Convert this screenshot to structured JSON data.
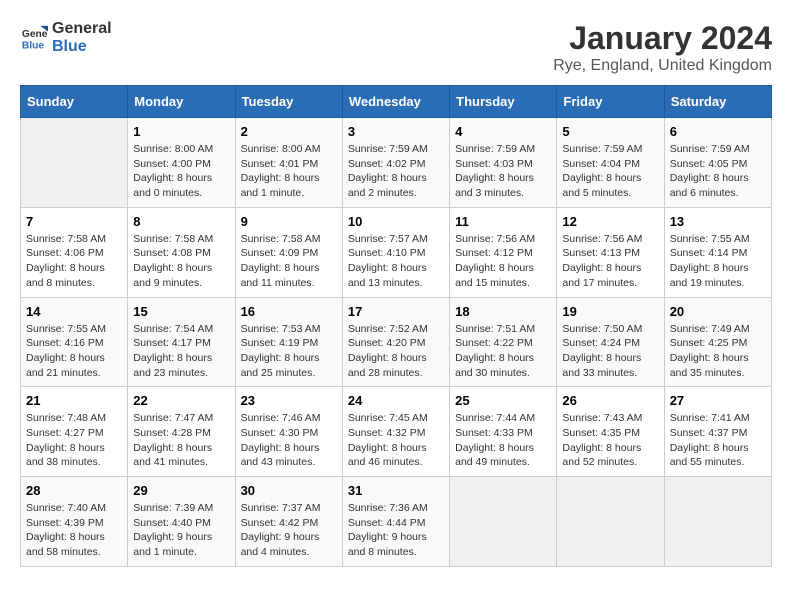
{
  "header": {
    "logo_general": "General",
    "logo_blue": "Blue",
    "title": "January 2024",
    "subtitle": "Rye, England, United Kingdom"
  },
  "calendar": {
    "days_of_week": [
      "Sunday",
      "Monday",
      "Tuesday",
      "Wednesday",
      "Thursday",
      "Friday",
      "Saturday"
    ],
    "weeks": [
      [
        {
          "day": "",
          "info": ""
        },
        {
          "day": "1",
          "info": "Sunrise: 8:00 AM\nSunset: 4:00 PM\nDaylight: 8 hours\nand 0 minutes."
        },
        {
          "day": "2",
          "info": "Sunrise: 8:00 AM\nSunset: 4:01 PM\nDaylight: 8 hours\nand 1 minute."
        },
        {
          "day": "3",
          "info": "Sunrise: 7:59 AM\nSunset: 4:02 PM\nDaylight: 8 hours\nand 2 minutes."
        },
        {
          "day": "4",
          "info": "Sunrise: 7:59 AM\nSunset: 4:03 PM\nDaylight: 8 hours\nand 3 minutes."
        },
        {
          "day": "5",
          "info": "Sunrise: 7:59 AM\nSunset: 4:04 PM\nDaylight: 8 hours\nand 5 minutes."
        },
        {
          "day": "6",
          "info": "Sunrise: 7:59 AM\nSunset: 4:05 PM\nDaylight: 8 hours\nand 6 minutes."
        }
      ],
      [
        {
          "day": "7",
          "info": "Sunrise: 7:58 AM\nSunset: 4:06 PM\nDaylight: 8 hours\nand 8 minutes."
        },
        {
          "day": "8",
          "info": "Sunrise: 7:58 AM\nSunset: 4:08 PM\nDaylight: 8 hours\nand 9 minutes."
        },
        {
          "day": "9",
          "info": "Sunrise: 7:58 AM\nSunset: 4:09 PM\nDaylight: 8 hours\nand 11 minutes."
        },
        {
          "day": "10",
          "info": "Sunrise: 7:57 AM\nSunset: 4:10 PM\nDaylight: 8 hours\nand 13 minutes."
        },
        {
          "day": "11",
          "info": "Sunrise: 7:56 AM\nSunset: 4:12 PM\nDaylight: 8 hours\nand 15 minutes."
        },
        {
          "day": "12",
          "info": "Sunrise: 7:56 AM\nSunset: 4:13 PM\nDaylight: 8 hours\nand 17 minutes."
        },
        {
          "day": "13",
          "info": "Sunrise: 7:55 AM\nSunset: 4:14 PM\nDaylight: 8 hours\nand 19 minutes."
        }
      ],
      [
        {
          "day": "14",
          "info": "Sunrise: 7:55 AM\nSunset: 4:16 PM\nDaylight: 8 hours\nand 21 minutes."
        },
        {
          "day": "15",
          "info": "Sunrise: 7:54 AM\nSunset: 4:17 PM\nDaylight: 8 hours\nand 23 minutes."
        },
        {
          "day": "16",
          "info": "Sunrise: 7:53 AM\nSunset: 4:19 PM\nDaylight: 8 hours\nand 25 minutes."
        },
        {
          "day": "17",
          "info": "Sunrise: 7:52 AM\nSunset: 4:20 PM\nDaylight: 8 hours\nand 28 minutes."
        },
        {
          "day": "18",
          "info": "Sunrise: 7:51 AM\nSunset: 4:22 PM\nDaylight: 8 hours\nand 30 minutes."
        },
        {
          "day": "19",
          "info": "Sunrise: 7:50 AM\nSunset: 4:24 PM\nDaylight: 8 hours\nand 33 minutes."
        },
        {
          "day": "20",
          "info": "Sunrise: 7:49 AM\nSunset: 4:25 PM\nDaylight: 8 hours\nand 35 minutes."
        }
      ],
      [
        {
          "day": "21",
          "info": "Sunrise: 7:48 AM\nSunset: 4:27 PM\nDaylight: 8 hours\nand 38 minutes."
        },
        {
          "day": "22",
          "info": "Sunrise: 7:47 AM\nSunset: 4:28 PM\nDaylight: 8 hours\nand 41 minutes."
        },
        {
          "day": "23",
          "info": "Sunrise: 7:46 AM\nSunset: 4:30 PM\nDaylight: 8 hours\nand 43 minutes."
        },
        {
          "day": "24",
          "info": "Sunrise: 7:45 AM\nSunset: 4:32 PM\nDaylight: 8 hours\nand 46 minutes."
        },
        {
          "day": "25",
          "info": "Sunrise: 7:44 AM\nSunset: 4:33 PM\nDaylight: 8 hours\nand 49 minutes."
        },
        {
          "day": "26",
          "info": "Sunrise: 7:43 AM\nSunset: 4:35 PM\nDaylight: 8 hours\nand 52 minutes."
        },
        {
          "day": "27",
          "info": "Sunrise: 7:41 AM\nSunset: 4:37 PM\nDaylight: 8 hours\nand 55 minutes."
        }
      ],
      [
        {
          "day": "28",
          "info": "Sunrise: 7:40 AM\nSunset: 4:39 PM\nDaylight: 8 hours\nand 58 minutes."
        },
        {
          "day": "29",
          "info": "Sunrise: 7:39 AM\nSunset: 4:40 PM\nDaylight: 9 hours\nand 1 minute."
        },
        {
          "day": "30",
          "info": "Sunrise: 7:37 AM\nSunset: 4:42 PM\nDaylight: 9 hours\nand 4 minutes."
        },
        {
          "day": "31",
          "info": "Sunrise: 7:36 AM\nSunset: 4:44 PM\nDaylight: 9 hours\nand 8 minutes."
        },
        {
          "day": "",
          "info": ""
        },
        {
          "day": "",
          "info": ""
        },
        {
          "day": "",
          "info": ""
        }
      ]
    ]
  }
}
